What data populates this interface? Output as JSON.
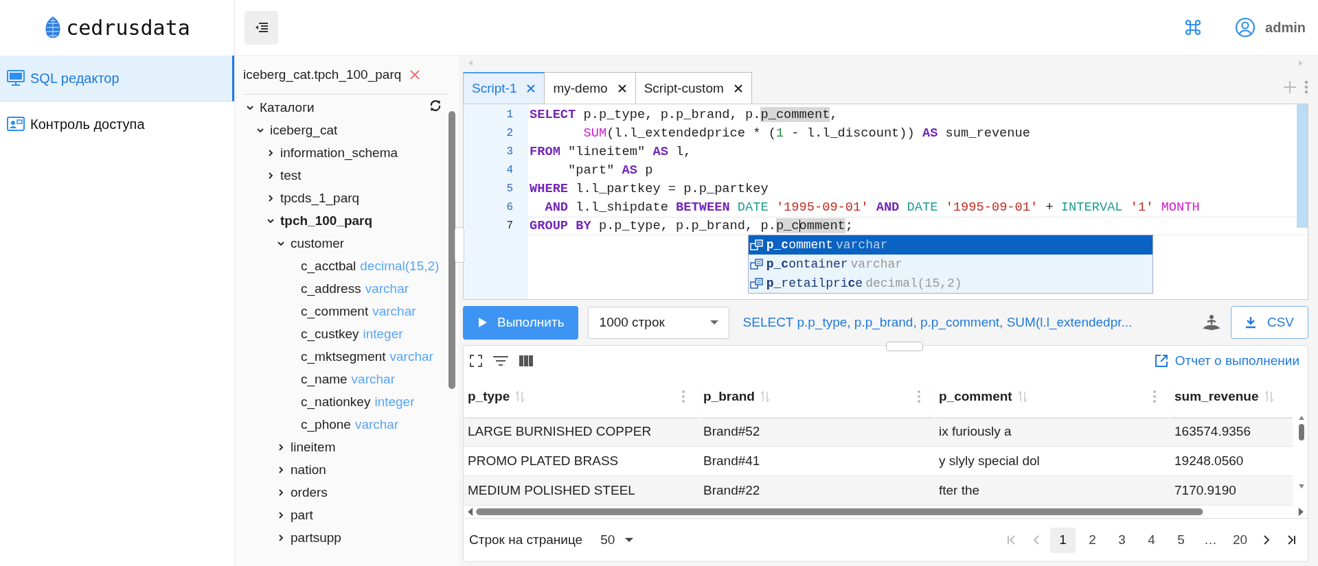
{
  "header": {
    "logo": "cedrusdata",
    "user": "admin"
  },
  "sidebar": {
    "items": [
      {
        "label": "SQL редактор",
        "selected": true
      },
      {
        "label": "Контроль доступа",
        "selected": false
      }
    ]
  },
  "explorer": {
    "title": "iceberg_cat.tpch_100_parq",
    "tree": [
      {
        "label": "Каталоги",
        "kind": "node",
        "expanded": true,
        "selected": false,
        "children": [
          {
            "label": "iceberg_cat",
            "kind": "node",
            "expanded": true,
            "selected": false,
            "children": [
              {
                "label": "information_schema",
                "kind": "node",
                "expanded": false,
                "selected": false
              },
              {
                "label": "test",
                "kind": "node",
                "expanded": false,
                "selected": false
              },
              {
                "label": "tpcds_1_parq",
                "kind": "node",
                "expanded": false,
                "selected": false
              },
              {
                "label": "tpch_100_parq",
                "kind": "node",
                "expanded": true,
                "selected": true,
                "children": [
                  {
                    "label": "customer",
                    "kind": "node",
                    "expanded": true,
                    "selected": false,
                    "children": [
                      {
                        "label": "c_acctbal",
                        "kind": "column",
                        "type": "decimal(15,2)",
                        "selected": false
                      },
                      {
                        "label": "c_address",
                        "kind": "column",
                        "type": "varchar",
                        "selected": false
                      },
                      {
                        "label": "c_comment",
                        "kind": "column",
                        "type": "varchar",
                        "selected": false
                      },
                      {
                        "label": "c_custkey",
                        "kind": "column",
                        "type": "integer",
                        "selected": false
                      },
                      {
                        "label": "c_mktsegment",
                        "kind": "column",
                        "type": "varchar",
                        "selected": false
                      },
                      {
                        "label": "c_name",
                        "kind": "column",
                        "type": "varchar",
                        "selected": false
                      },
                      {
                        "label": "c_nationkey",
                        "kind": "column",
                        "type": "integer",
                        "selected": false
                      },
                      {
                        "label": "c_phone",
                        "kind": "column",
                        "type": "varchar",
                        "selected": false
                      }
                    ]
                  },
                  {
                    "label": "lineitem",
                    "kind": "node",
                    "expanded": false,
                    "selected": false
                  },
                  {
                    "label": "nation",
                    "kind": "node",
                    "expanded": false,
                    "selected": false
                  },
                  {
                    "label": "orders",
                    "kind": "node",
                    "expanded": false,
                    "selected": false
                  },
                  {
                    "label": "part",
                    "kind": "node",
                    "expanded": false,
                    "selected": false
                  },
                  {
                    "label": "partsupp",
                    "kind": "node",
                    "expanded": false,
                    "selected": false
                  }
                ]
              }
            ]
          }
        ]
      }
    ]
  },
  "tabs": [
    {
      "label": "Script-1",
      "selected": true
    },
    {
      "label": "my-demo",
      "selected": false
    },
    {
      "label": "Script-custom",
      "selected": false
    }
  ],
  "editor": {
    "lines": [
      {
        "number": "1",
        "current": false,
        "tokens": [
          {
            "kind": "keyword",
            "text": "SELECT "
          },
          {
            "kind": "plain",
            "text": "p.p_type, p.p_brand, p."
          },
          {
            "kind": "highlight",
            "text": "p_comment"
          },
          {
            "kind": "plain",
            "text": ","
          }
        ]
      },
      {
        "number": "2",
        "current": false,
        "tokens": [
          {
            "kind": "function",
            "text": "       SUM"
          },
          {
            "kind": "plain",
            "text": "(l.l_extendedprice * ("
          },
          {
            "kind": "number",
            "text": "1"
          },
          {
            "kind": "plain",
            "text": " - l.l_discount)) "
          },
          {
            "kind": "keyword",
            "text": "AS "
          },
          {
            "kind": "plain",
            "text": "sum_revenue"
          }
        ]
      },
      {
        "number": "3",
        "current": false,
        "tokens": [
          {
            "kind": "keyword",
            "text": "FROM "
          },
          {
            "kind": "plain",
            "text": "\"lineitem\" "
          },
          {
            "kind": "keyword",
            "text": "AS "
          },
          {
            "kind": "plain",
            "text": "l,"
          }
        ]
      },
      {
        "number": "4",
        "current": false,
        "tokens": [
          {
            "kind": "plain",
            "text": "     \"part\" "
          },
          {
            "kind": "keyword",
            "text": "AS "
          },
          {
            "kind": "plain",
            "text": "p"
          }
        ]
      },
      {
        "number": "5",
        "current": false,
        "tokens": [
          {
            "kind": "keyword",
            "text": "WHERE "
          },
          {
            "kind": "plain",
            "text": "l.l_partkey = p.p_partkey"
          }
        ]
      },
      {
        "number": "6",
        "current": false,
        "tokens": [
          {
            "kind": "keyword",
            "text": "  AND "
          },
          {
            "kind": "plain",
            "text": "l.l_shipdate "
          },
          {
            "kind": "keyword",
            "text": "BETWEEN "
          },
          {
            "kind": "type",
            "text": "DATE "
          },
          {
            "kind": "string",
            "text": "'1995-09-01' "
          },
          {
            "kind": "keyword",
            "text": "AND "
          },
          {
            "kind": "type",
            "text": "DATE "
          },
          {
            "kind": "string",
            "text": "'1995-09-01' "
          },
          {
            "kind": "plain",
            "text": "+ "
          },
          {
            "kind": "type",
            "text": "INTERVAL "
          },
          {
            "kind": "string",
            "text": "'1' "
          },
          {
            "kind": "function",
            "text": "MONTH"
          }
        ]
      },
      {
        "number": "7",
        "current": true,
        "tokens": [
          {
            "kind": "keyword",
            "text": "GROUP BY "
          },
          {
            "kind": "plain",
            "text": "p.p_type, p.p_brand, p."
          },
          {
            "kind": "highlight",
            "text": "p_comment"
          },
          {
            "kind": "plain",
            "text": ";"
          }
        ]
      }
    ],
    "suggestions": [
      {
        "name": "**p_c**omment",
        "type": "varchar",
        "selected": true
      },
      {
        "name": "**p_c**ontainer",
        "type": "varchar",
        "selected": false
      },
      {
        "name": "**p_**retailpri**c**e",
        "type": "decimal(15,2)",
        "selected": false
      }
    ]
  },
  "toolbar": {
    "run": "Выполнить",
    "limit": "1000 строк",
    "query": "SELECT p.p_type, p.p_brand, p.p_comment, SUM(l.l_extendedpr...",
    "export": "CSV"
  },
  "results": {
    "report_link": "Отчет о выполнении",
    "columns": [
      "p_type",
      "p_brand",
      "p_comment",
      "sum_revenue"
    ],
    "rows": [
      [
        "LARGE BURNISHED COPPER",
        "Brand#52",
        "ix furiously a",
        "163574.9356"
      ],
      [
        "PROMO PLATED BRASS",
        "Brand#41",
        "y slyly special dol",
        "19248.0560"
      ],
      [
        "MEDIUM POLISHED STEEL",
        "Brand#22",
        "fter the",
        "7170.9190"
      ]
    ],
    "pagination": {
      "rows_label": "Строк на странице",
      "page_size": "50",
      "pages": [
        {
          "label": "1",
          "selected": true
        },
        {
          "label": "2",
          "selected": false
        },
        {
          "label": "3",
          "selected": false
        },
        {
          "label": "4",
          "selected": false
        },
        {
          "label": "5",
          "selected": false
        },
        {
          "label": "…",
          "selected": false
        },
        {
          "label": "20",
          "selected": false
        }
      ]
    }
  }
}
